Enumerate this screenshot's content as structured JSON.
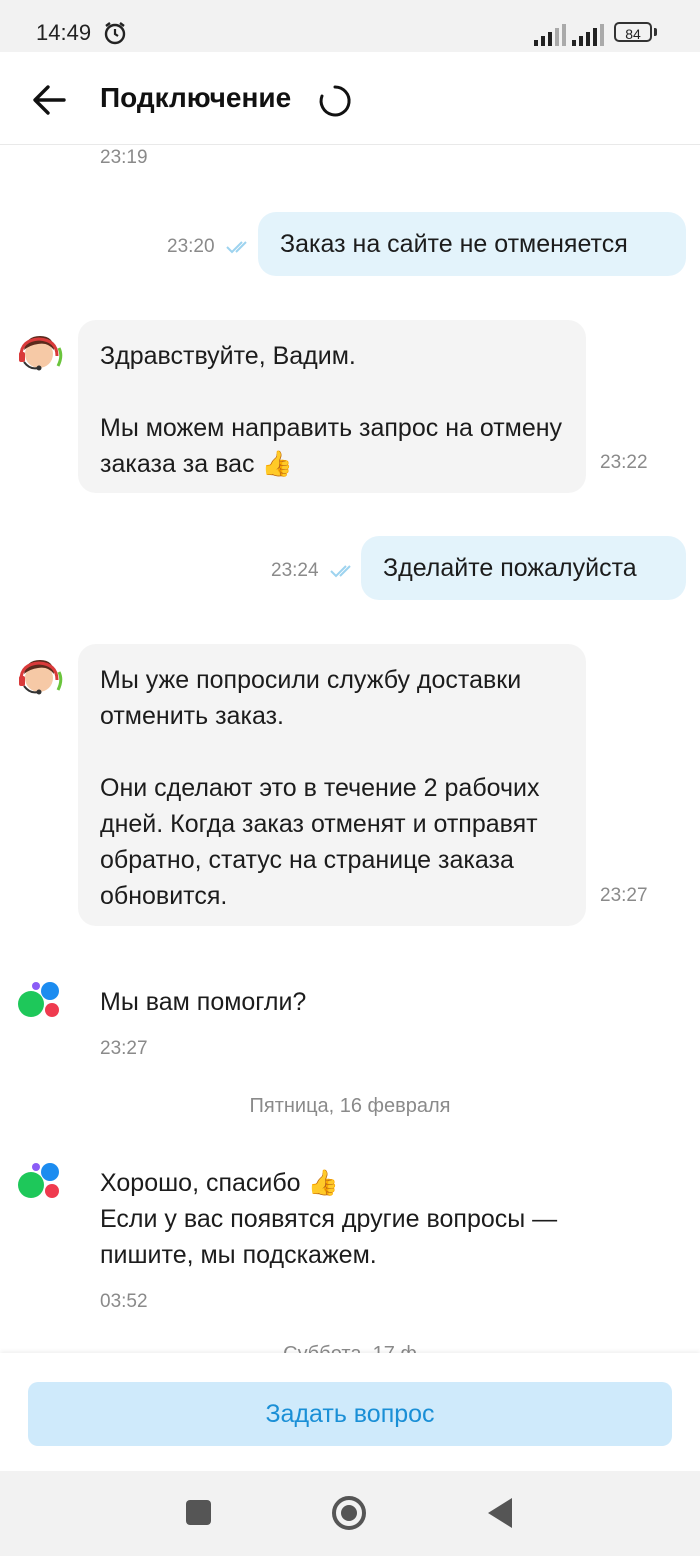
{
  "status_bar": {
    "time": "14:49",
    "battery": "84"
  },
  "header": {
    "title": "Подключение"
  },
  "messages": [
    {
      "type": "time_only",
      "time": "23:19"
    },
    {
      "type": "outgoing",
      "text": "Заказ на сайте не отменяется",
      "time": "23:20",
      "status": "read"
    },
    {
      "type": "incoming_operator",
      "text": "Здравствуйте, Вадим.\n\nМы можем направить запрос на отмену заказа за вас 👍",
      "time": "23:22"
    },
    {
      "type": "outgoing",
      "text": "Зделайте пожалуйста",
      "time": "23:24",
      "status": "read"
    },
    {
      "type": "incoming_operator",
      "text": "Мы уже попросили службу доставки отменить заказ.\n\nОни сделают это в течение 2 рабочих дней. Когда заказ отменят и отправят обратно, статус на странице заказа обновится.",
      "time": "23:27"
    },
    {
      "type": "incoming_bot",
      "text": "Мы вам помогли?",
      "time": "23:27"
    },
    {
      "type": "date_separator",
      "text": "Пятница, 16 февраля"
    },
    {
      "type": "incoming_bot",
      "text": "Хорошо, спасибо 👍\nЕсли у вас появятся другие вопросы — пишите, мы подскажем.",
      "time": "03:52"
    },
    {
      "type": "date_separator_partial",
      "text": "Суббота, 17 ф"
    }
  ],
  "bottom": {
    "ask_button": "Задать вопрос"
  },
  "colors": {
    "outgoing_bubble": "#e3f3fb",
    "incoming_bubble": "#f4f4f4",
    "ask_button_bg": "#cfeafb",
    "ask_button_text": "#1a8fd6",
    "bot_logo": [
      "#1ec85a",
      "#1c8cf0",
      "#ef3b4f",
      "#8b5cf6"
    ]
  },
  "icons": [
    "back-arrow-icon",
    "loading-spinner-icon",
    "alarm-icon",
    "signal-icon",
    "read-check-icon",
    "operator-avatar",
    "bot-logo-icon"
  ]
}
